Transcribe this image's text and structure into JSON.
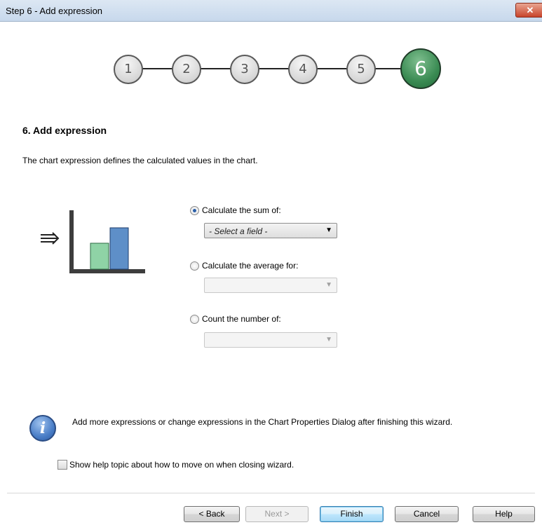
{
  "window": {
    "title": "Step 6 - Add expression",
    "close_label": "✕"
  },
  "steps": [
    {
      "label": "1",
      "active": false
    },
    {
      "label": "2",
      "active": false
    },
    {
      "label": "3",
      "active": false
    },
    {
      "label": "4",
      "active": false
    },
    {
      "label": "5",
      "active": false
    },
    {
      "label": "6",
      "active": true
    }
  ],
  "main": {
    "heading": "6. Add expression",
    "description": "The chart expression defines the calculated values in the chart."
  },
  "options": {
    "sum": {
      "label": "Calculate the sum of:",
      "selected": true,
      "field_value": "- Select a field -"
    },
    "average": {
      "label": "Calculate the average for:",
      "selected": false,
      "field_value": ""
    },
    "count": {
      "label": "Count the number of:",
      "selected": false,
      "field_value": ""
    }
  },
  "info": {
    "text": "Add more expressions or change expressions in the Chart Properties Dialog after finishing this wizard."
  },
  "help_checkbox": {
    "label": "Show help topic about how to move on when closing wizard.",
    "checked": false
  },
  "buttons": {
    "back": "< Back",
    "next": "Next >",
    "finish": "Finish",
    "cancel": "Cancel",
    "help": "Help"
  },
  "colors": {
    "active_step": "#3a8b53",
    "bar_green": "#8fd3a6",
    "bar_blue": "#5e8fc8"
  }
}
